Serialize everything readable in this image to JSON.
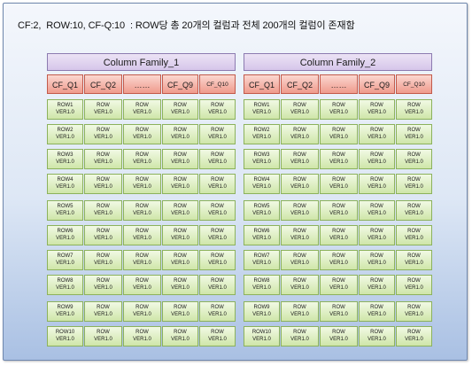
{
  "caption": "CF:2,  ROW:10, CF-Q:10  : ROW당 총 20개의 컬럼과 전체 200개의 컬럼이 존재함",
  "families": [
    {
      "name": "Column  Family_1",
      "qualifiers": [
        "CF_Q1",
        "CF_Q2",
        "……",
        "CF_Q9",
        "CF_Q10"
      ],
      "rows": [
        {
          "key": "ROW1",
          "ver": "VER1.0",
          "cell_top": "ROW",
          "cell_bottom": "VER1.0"
        },
        {
          "key": "ROW2",
          "ver": "VER1.0",
          "cell_top": "ROW",
          "cell_bottom": "VER1.0"
        },
        {
          "key": "ROW3",
          "ver": "VER1.0",
          "cell_top": "ROW",
          "cell_bottom": "VER1.0"
        },
        {
          "key": "ROW4",
          "ver": "VER1.0",
          "cell_top": "ROW",
          "cell_bottom": "VER1.0"
        },
        {
          "key": "ROW5",
          "ver": "VER1.0",
          "cell_top": "ROW",
          "cell_bottom": "VER1.0"
        },
        {
          "key": "ROW6",
          "ver": "VER1.0",
          "cell_top": "ROW",
          "cell_bottom": "VER1.0"
        },
        {
          "key": "ROW7",
          "ver": "VER1.0",
          "cell_top": "ROW",
          "cell_bottom": "VER1.0"
        },
        {
          "key": "ROW8",
          "ver": "VER1.0",
          "cell_top": "ROW",
          "cell_bottom": "VER1.0"
        },
        {
          "key": "ROW9",
          "ver": "VER1.0",
          "cell_top": "ROW",
          "cell_bottom": "VER1.0"
        },
        {
          "key": "ROW10",
          "ver": "VER1.0",
          "cell_top": "ROW",
          "cell_bottom": "VER1.0"
        }
      ]
    },
    {
      "name": "Column  Family_2",
      "qualifiers": [
        "CF_Q1",
        "CF_Q2",
        "……",
        "CF_Q9",
        "CF_Q10"
      ],
      "rows": [
        {
          "key": "ROW1",
          "ver": "VER1.0",
          "cell_top": "ROW",
          "cell_bottom": "VER1.0"
        },
        {
          "key": "ROW2",
          "ver": "VER1.0",
          "cell_top": "ROW",
          "cell_bottom": "VER1.0"
        },
        {
          "key": "ROW3",
          "ver": "VER1.0",
          "cell_top": "ROW",
          "cell_bottom": "VER1.0"
        },
        {
          "key": "ROW4",
          "ver": "VER1.0",
          "cell_top": "ROW",
          "cell_bottom": "VER1.0"
        },
        {
          "key": "ROW5",
          "ver": "VER1.0",
          "cell_top": "ROW",
          "cell_bottom": "VER1.0"
        },
        {
          "key": "ROW6",
          "ver": "VER1.0",
          "cell_top": "ROW",
          "cell_bottom": "VER1.0"
        },
        {
          "key": "ROW7",
          "ver": "VER1.0",
          "cell_top": "ROW",
          "cell_bottom": "VER1.0"
        },
        {
          "key": "ROW8",
          "ver": "VER1.0",
          "cell_top": "ROW",
          "cell_bottom": "VER1.0"
        },
        {
          "key": "ROW9",
          "ver": "VER1.0",
          "cell_top": "ROW",
          "cell_bottom": "VER1.0"
        },
        {
          "key": "ROW10",
          "ver": "VER1.0",
          "cell_top": "ROW",
          "cell_bottom": "VER1.0"
        }
      ]
    }
  ],
  "colors": {
    "family_header": "#d6c6ea",
    "qualifier": "#ef9a8c",
    "cell": "#cfe6a9",
    "panel": "#a9c0e3"
  }
}
